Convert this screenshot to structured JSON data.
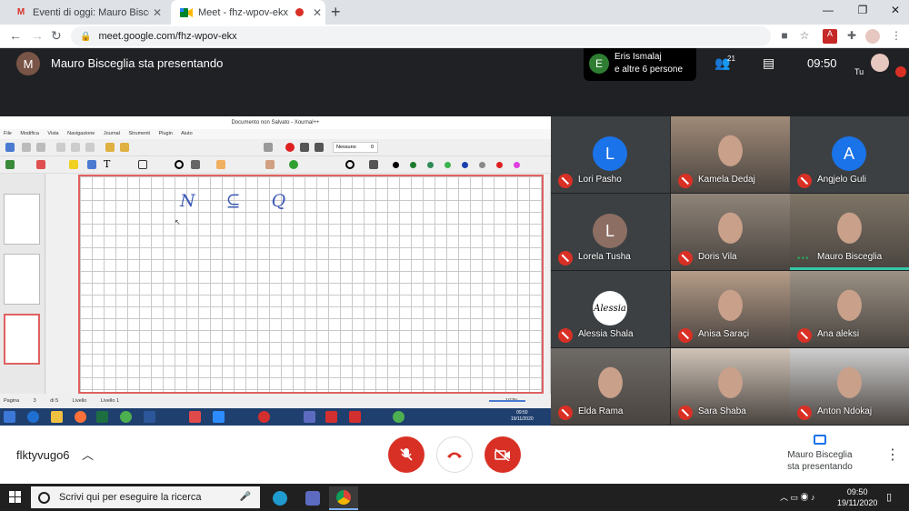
{
  "browser": {
    "tabs": [
      {
        "title": "Eventi di oggi: Mauro Bisceglia t",
        "icon": "gmail-icon"
      },
      {
        "title": "Meet - fhz-wpov-ekx",
        "icon": "meet-icon",
        "recording": true
      }
    ],
    "url": "meet.google.com/fhz-wpov-ekx"
  },
  "meet": {
    "presenter_initial": "M",
    "presenter_title": "Mauro Bisceglia sta presentando",
    "chip": {
      "initial": "E",
      "line1": "Eris Ismalaj",
      "line2": "e altre 6 persone"
    },
    "people_count": "21",
    "time": "09:50",
    "self_label": "Tu",
    "meeting_code": "flktyvugo6",
    "presenting_label_1": "Mauro Bisceglia",
    "presenting_label_2": "sta presentando"
  },
  "xournal": {
    "window_title": "Documento non Salvato - Xournal++",
    "menu": [
      "File",
      "Modifica",
      "Vista",
      "Navigazione",
      "Journal",
      "Strumenti",
      "Plugin",
      "Aiuto"
    ],
    "zoom_label": "Nessuno",
    "zoom_value": "0",
    "formula": "N ⊆ Q",
    "status": {
      "page_label": "Pagina",
      "page_value": "3",
      "page_of": "di 5",
      "layer_label": "Livello",
      "layer_value": "Livello 1",
      "zoom": "102%"
    },
    "remote_clock": {
      "time": "09:50",
      "date": "19/11/2020"
    },
    "colors": [
      "#000000",
      "#1a7a2a",
      "#2e8b57",
      "#3bb34a",
      "#1c3fae",
      "#888888",
      "#e02020",
      "#e040e0"
    ]
  },
  "participants": [
    {
      "name": "Lori Pasho",
      "initial": "L",
      "avatar_color": "#1a73e8",
      "video": false
    },
    {
      "name": "Kamela Dedaj",
      "video": true,
      "tone": "#a08a78"
    },
    {
      "name": "Angjelo Guli",
      "initial": "A",
      "avatar_color": "#1a73e8",
      "video": false
    },
    {
      "name": "Lorela Tusha",
      "initial": "L",
      "avatar_color": "#8d6e63",
      "video": false
    },
    {
      "name": "Doris Vila",
      "video": true,
      "tone": "#8f8478"
    },
    {
      "name": "Mauro Bisceglia",
      "video": true,
      "tone": "#7e7566",
      "speaking": true
    },
    {
      "name": "Alessia Shala",
      "initial": "Alessia",
      "avatar_color": "#ffffff",
      "video": false
    },
    {
      "name": "Anisa Saraçi",
      "video": true,
      "tone": "#b59c88"
    },
    {
      "name": "Ana aleksi",
      "video": true,
      "tone": "#9b9184"
    },
    {
      "name": "Elda Rama",
      "video": true,
      "tone": "#6e6a66"
    },
    {
      "name": "Sara Shaba",
      "video": true,
      "tone": "#d0c4b8"
    },
    {
      "name": "Anton Ndokaj",
      "video": true,
      "tone": "#cfcfcf"
    }
  ],
  "taskbar": {
    "search_placeholder": "Scrivi qui per eseguire la ricerca",
    "time": "09:50",
    "date": "19/11/2020"
  },
  "theme": {
    "danger": "#d93025",
    "meet_dark": "#202124",
    "accent": "#1a73e8"
  }
}
